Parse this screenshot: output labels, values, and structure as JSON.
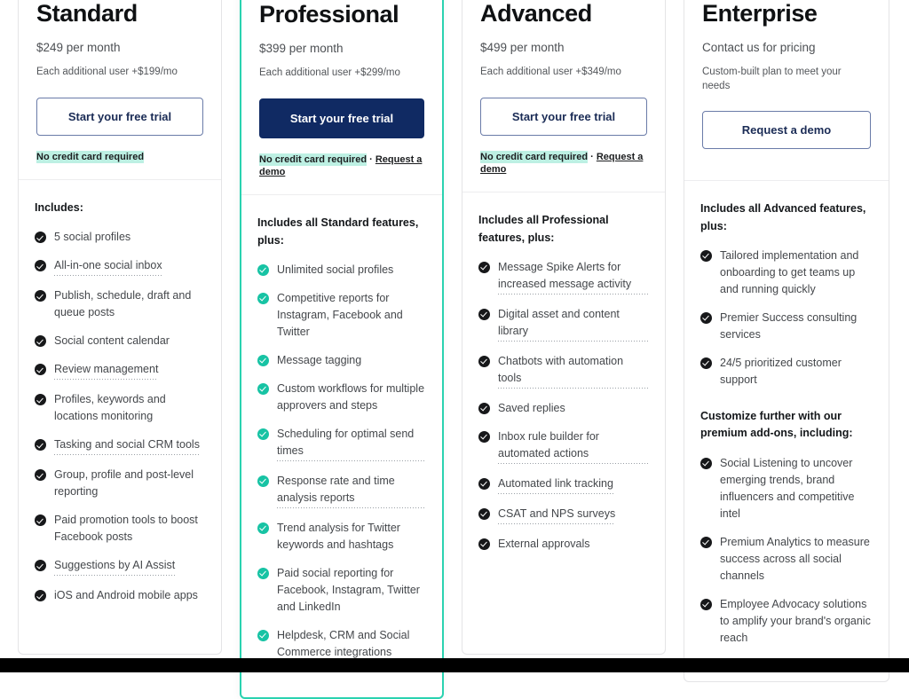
{
  "plans": [
    {
      "name": "Standard",
      "price": "$249 per month",
      "extra_user": "Each additional user +$199/mo",
      "cta_label": "Start your free trial",
      "cta_style": "outline",
      "note_highlight": "No credit card required",
      "note_separator": "",
      "note_link": "",
      "featured": false,
      "includes_title": "Includes:",
      "features": [
        {
          "text": "5 social profiles",
          "dotted": false
        },
        {
          "text": "All-in-one social inbox",
          "dotted": true
        },
        {
          "text": "Publish, schedule, draft and queue posts",
          "dotted": false
        },
        {
          "text": "Social content calendar",
          "dotted": false
        },
        {
          "text": "Review management",
          "dotted": true
        },
        {
          "text": "Profiles, keywords and locations monitoring",
          "dotted": false
        },
        {
          "text": "Tasking and social CRM tools",
          "dotted": true
        },
        {
          "text": "Group, profile and post-level reporting",
          "dotted": false
        },
        {
          "text": "Paid promotion tools to boost Facebook posts",
          "dotted": false
        },
        {
          "text": "Suggestions by AI Assist",
          "dotted": true
        },
        {
          "text": "iOS and Android mobile apps",
          "dotted": false
        }
      ],
      "second_title": "",
      "second_features": []
    },
    {
      "name": "Professional",
      "price": "$399 per month",
      "extra_user": "Each additional user +$299/mo",
      "cta_label": "Start your free trial",
      "cta_style": "solid",
      "note_highlight": "No credit card required",
      "note_separator": " · ",
      "note_link": "Request a demo",
      "featured": true,
      "includes_title": "Includes all Standard features, plus:",
      "features": [
        {
          "text": "Unlimited social profiles",
          "dotted": false
        },
        {
          "text": "Competitive reports for Instagram, Facebook and Twitter",
          "dotted": false
        },
        {
          "text": "Message tagging",
          "dotted": false
        },
        {
          "text": "Custom workflows for multiple approvers and steps",
          "dotted": false
        },
        {
          "text": "Scheduling for optimal send times",
          "dotted": true
        },
        {
          "text": "Response rate and time analysis reports",
          "dotted": true
        },
        {
          "text": "Trend analysis for Twitter keywords and hashtags",
          "dotted": false
        },
        {
          "text": "Paid social reporting for Facebook, Instagram, Twitter and LinkedIn",
          "dotted": false
        },
        {
          "text": "Helpdesk, CRM and Social Commerce integrations",
          "dotted": true
        }
      ],
      "second_title": "",
      "second_features": []
    },
    {
      "name": "Advanced",
      "price": "$499 per month",
      "extra_user": "Each additional user +$349/mo",
      "cta_label": "Start your free trial",
      "cta_style": "outline",
      "note_highlight": "No credit card required",
      "note_separator": " · ",
      "note_link": "Request a demo",
      "featured": false,
      "includes_title": "Includes all Professional features, plus:",
      "features": [
        {
          "text": "Message Spike Alerts for increased message activity",
          "dotted": true
        },
        {
          "text": "Digital asset and content library",
          "dotted": true
        },
        {
          "text": "Chatbots with automation tools",
          "dotted": true
        },
        {
          "text": "Saved replies",
          "dotted": false
        },
        {
          "text": "Inbox rule builder for automated actions",
          "dotted": true
        },
        {
          "text": "Automated link tracking",
          "dotted": true
        },
        {
          "text": "CSAT and NPS surveys",
          "dotted": true
        },
        {
          "text": "External approvals",
          "dotted": false
        }
      ],
      "second_title": "",
      "second_features": []
    },
    {
      "name": "Enterprise",
      "price": "Contact us for pricing",
      "extra_user": "Custom-built plan to meet your needs",
      "cta_label": "Request a demo",
      "cta_style": "outline",
      "note_highlight": "",
      "note_separator": "",
      "note_link": "",
      "featured": false,
      "includes_title": "Includes all Advanced features, plus:",
      "features": [
        {
          "text": "Tailored implementation and onboarding to get teams up and running quickly",
          "dotted": false
        },
        {
          "text": "Premier Success consulting services",
          "dotted": false
        },
        {
          "text": "24/5 prioritized customer support",
          "dotted": false
        }
      ],
      "second_title": "Customize further with our premium add-ons, including:",
      "second_features": [
        {
          "text": "Social Listening to uncover emerging trends, brand influencers and competitive intel",
          "dotted": false
        },
        {
          "text": "Premium Analytics to measure success across all social channels",
          "dotted": false
        },
        {
          "text": "Employee Advocacy solutions to amplify your brand's organic reach",
          "dotted": false
        }
      ]
    }
  ],
  "colors": {
    "featured_border": "#2ad2b0",
    "featured_check": "#17c3a4",
    "standard_check": "#17181a",
    "solid_button_bg": "#102a63",
    "outline_button_border": "#6a7ba8",
    "highlight_bg": "#bdf0e3",
    "bottom_bar": "#000000"
  }
}
